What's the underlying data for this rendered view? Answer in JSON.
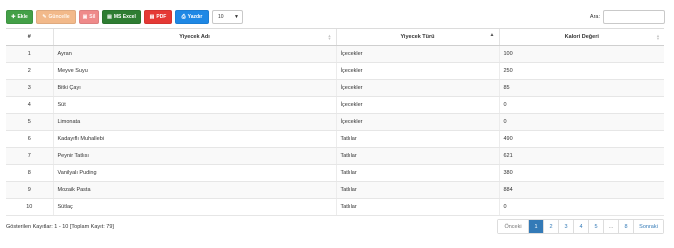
{
  "toolbar": {
    "add_label": "Ekle",
    "edit_label": "Güncelle",
    "delete_label": "Sil",
    "excel_label": "MS Excel",
    "pdf_label": "PDF",
    "print_label": "Yazdır",
    "page_length": "10"
  },
  "search": {
    "label": "Ara:",
    "value": ""
  },
  "table": {
    "headers": {
      "index": "#",
      "name": "Yiyecek Adı",
      "type": "Yiyecek Türü",
      "calorie": "Kalori Değeri"
    },
    "rows": [
      {
        "no": "1",
        "name": "Ayran",
        "type": "İçecekler",
        "calorie": "100"
      },
      {
        "no": "2",
        "name": "Meyve Suyu",
        "type": "İçecekler",
        "calorie": "250"
      },
      {
        "no": "3",
        "name": "Bitki Çayı",
        "type": "İçecekler",
        "calorie": "85"
      },
      {
        "no": "4",
        "name": "Süt",
        "type": "İçecekler",
        "calorie": "0"
      },
      {
        "no": "5",
        "name": "Limonata",
        "type": "İçecekler",
        "calorie": "0"
      },
      {
        "no": "6",
        "name": "Kadayıflı Muhallebi",
        "type": "Tatlılar",
        "calorie": "490"
      },
      {
        "no": "7",
        "name": "Peynir Tatlısı",
        "type": "Tatlılar",
        "calorie": "621"
      },
      {
        "no": "8",
        "name": "Vanilyalı Puding",
        "type": "Tatlılar",
        "calorie": "380"
      },
      {
        "no": "9",
        "name": "Mozaik Pasta",
        "type": "Tatlılar",
        "calorie": "884"
      },
      {
        "no": "10",
        "name": "Sütlaç",
        "type": "Tatlılar",
        "calorie": "0"
      }
    ]
  },
  "footer": {
    "info": "Gösterilen Kayıtlar: 1 - 10 [Toplam Kayıt: 79]"
  },
  "pagination": {
    "prev": "Önceki",
    "pages": [
      "1",
      "2",
      "3",
      "4",
      "5"
    ],
    "ellipsis": "…",
    "last": "8",
    "next": "Sonraki",
    "active": "1"
  },
  "icons": {
    "add": "plus-icon",
    "edit": "pencil-icon",
    "delete": "trash-icon",
    "excel": "file-excel-icon",
    "pdf": "file-pdf-icon",
    "print": "printer-icon"
  }
}
